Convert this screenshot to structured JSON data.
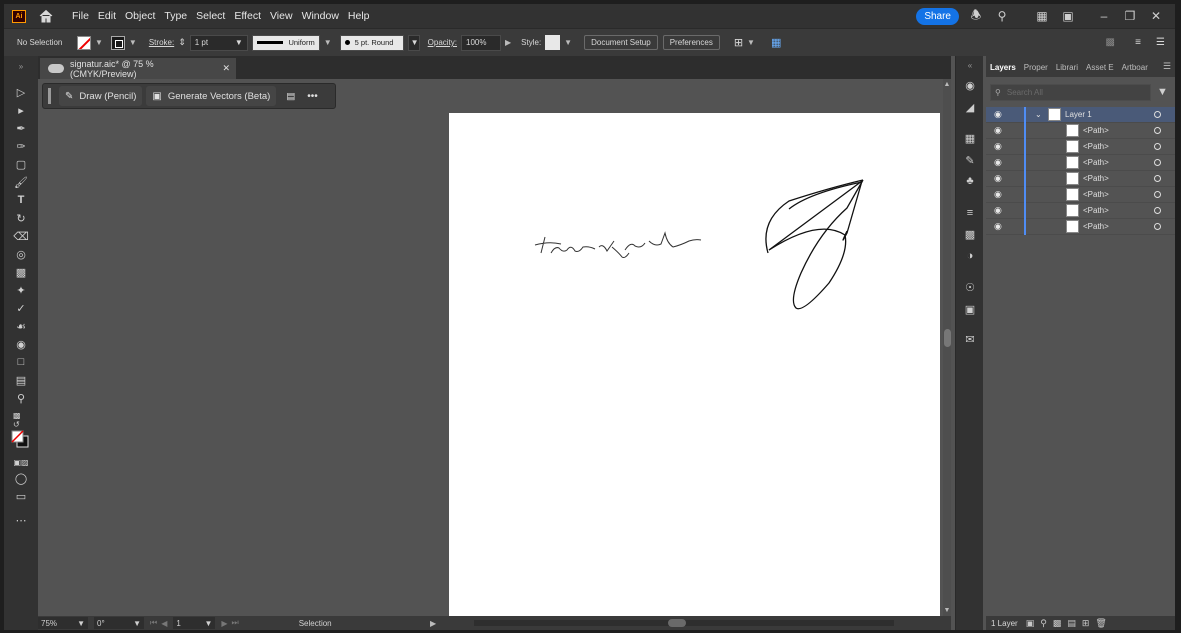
{
  "menubar": {
    "app_badge": "Ai",
    "items": [
      "File",
      "Edit",
      "Object",
      "Type",
      "Select",
      "Effect",
      "View",
      "Window",
      "Help"
    ],
    "share_label": "Share"
  },
  "controlbar": {
    "selection_text": "No Selection",
    "stroke_label": "Stroke:",
    "stroke_weight": "1 pt",
    "profile": "Uniform",
    "brush": "5 pt. Round",
    "opacity_label": "Opacity:",
    "opacity_value": "100%",
    "style_label": "Style:",
    "document_setup": "Document Setup",
    "preferences": "Preferences"
  },
  "document": {
    "tab_title": "signatur.aic* @ 75 % (CMYK/Preview)"
  },
  "context_bar": {
    "draw_label": "Draw (Pencil)",
    "generate_label": "Generate Vectors (Beta)",
    "more": "•••"
  },
  "statusbar": {
    "zoom": "75%",
    "rotation": "0°",
    "artboard_number": "1",
    "tool_status": "Selection"
  },
  "layers_panel": {
    "tabs": [
      "Layers",
      "Proper",
      "Librari",
      "Asset E",
      "Artboar"
    ],
    "search_placeholder": "Search All",
    "layer_name": "Layer 1",
    "paths": [
      "<Path>",
      "<Path>",
      "<Path>",
      "<Path>",
      "<Path>",
      "<Path>",
      "<Path>"
    ],
    "footer": "1 Layer"
  },
  "colors": {
    "accent": "#1473e6",
    "layer_color": "#4f8df5",
    "selected_row": "#4a5a78",
    "app_bg": "#535353"
  }
}
